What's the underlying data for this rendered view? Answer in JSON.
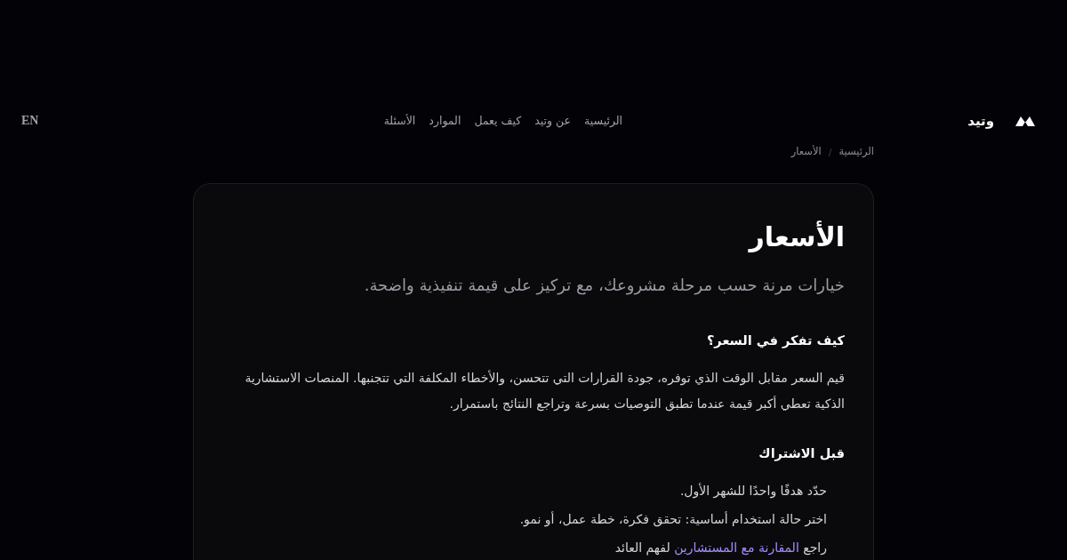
{
  "header": {
    "language_switch": "EN",
    "nav": [
      {
        "label": "الرئيسية"
      },
      {
        "label": "عن وتيد"
      },
      {
        "label": "كيف يعمل"
      },
      {
        "label": "الموارد"
      },
      {
        "label": "الأسئلة"
      }
    ],
    "brand": "وتيد"
  },
  "breadcrumb": {
    "items": [
      "الرئيسية",
      "الأسعار"
    ],
    "separator": "/"
  },
  "page": {
    "title": "الأسعار",
    "subtitle": "خيارات مرنة حسب مرحلة مشروعك، مع تركيز على قيمة تنفيذية واضحة.",
    "sections": [
      {
        "kind": "paragraph",
        "heading": "كيف تفكر في السعر؟",
        "text": "قيم السعر مقابل الوقت الذي توفره، جودة القرارات التي تتحسن، والأخطاء المكلفة التي تتجنبها. المنصات الاستشارية الذكية تعطي أكبر قيمة عندما تطبق التوصيات بسرعة وتراجع النتائج باستمرار."
      },
      {
        "kind": "list",
        "heading": "قبل الاشتراك",
        "items": [
          [
            {
              "kind": "text",
              "text": "حدّد هدفًا واحدًا للشهر الأول."
            }
          ],
          [
            {
              "kind": "text",
              "text": "اختر حالة استخدام أساسية: تحقق فكرة، خطة عمل، أو نمو."
            }
          ],
          [
            {
              "kind": "text",
              "text": "راجع "
            },
            {
              "kind": "link",
              "text": "المقارنة مع المستشارين"
            },
            {
              "kind": "text",
              "text": " لفهم العائد"
            }
          ]
        ]
      }
    ]
  }
}
